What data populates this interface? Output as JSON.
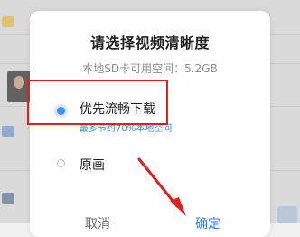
{
  "dialog": {
    "title": "请选择视频清晰度",
    "storage_text": "本地SD卡可用空间：5.2GB",
    "options": [
      {
        "label": "优先流畅下载",
        "hint": "最多节约70%本地空间",
        "selected": true
      },
      {
        "label": "原画",
        "selected": false
      }
    ],
    "cancel_label": "取消",
    "confirm_label": "确定"
  },
  "colors": {
    "accent": "#2f86ff",
    "annotation": "#e02020",
    "dialog_bg": "#ffffff",
    "backdrop": "#ededed"
  },
  "icons": {
    "selected_radio": "filled-blue-circle",
    "unselected_radio": "empty-circle"
  }
}
